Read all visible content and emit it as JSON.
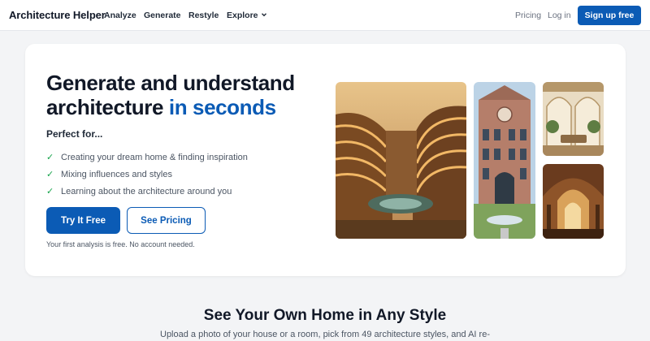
{
  "nav": {
    "brand": "Architecture Helper",
    "links": [
      "Analyze",
      "Generate",
      "Restyle",
      "Explore"
    ],
    "pricing": "Pricing",
    "login": "Log in",
    "signup": "Sign up free"
  },
  "hero": {
    "headline_part1": "Generate and understand architecture ",
    "headline_highlight": "in seconds",
    "perfect_for": "Perfect for...",
    "benefits": [
      "Creating your dream home & finding inspiration",
      "Mixing influences and styles",
      "Learning about the architecture around you"
    ],
    "primary_cta": "Try It Free",
    "secondary_cta": "See Pricing",
    "note": "Your first analysis is free. No account needed."
  },
  "section": {
    "title": "See Your Own Home in Any Style",
    "subtitle": "Upload a photo of your house or a room, pick from 49 architecture styles, and AI re-"
  },
  "colors": {
    "accent": "#0b5bb5",
    "check": "#16a34a",
    "background": "#f3f4f6"
  }
}
